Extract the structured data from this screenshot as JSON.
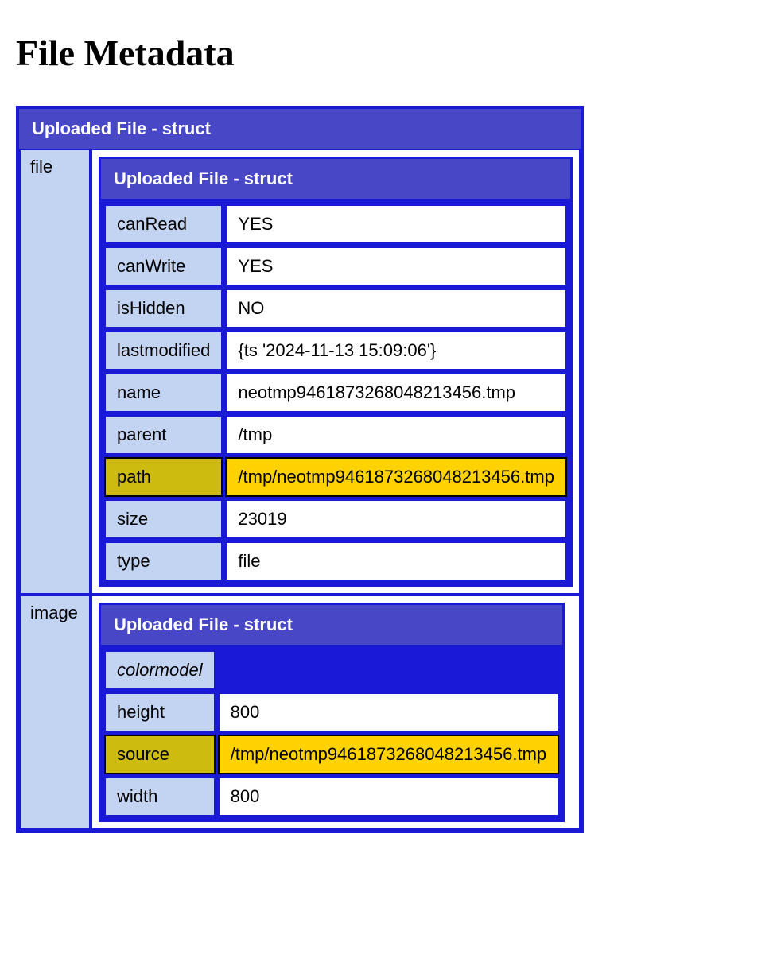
{
  "page_title": "File Metadata",
  "outer_struct_label": "Uploaded File - struct",
  "file_key": "file",
  "image_key": "image",
  "inner_struct_label": "Uploaded File - struct",
  "file_struct": {
    "canRead": {
      "k": "canRead",
      "v": "YES"
    },
    "canWrite": {
      "k": "canWrite",
      "v": "YES"
    },
    "isHidden": {
      "k": "isHidden",
      "v": "NO"
    },
    "lastmodified": {
      "k": "lastmodified",
      "v": "{ts '2024-11-13 15:09:06'}"
    },
    "name": {
      "k": "name",
      "v": "neotmp9461873268048213456.tmp"
    },
    "parent": {
      "k": "parent",
      "v": "/tmp"
    },
    "path": {
      "k": "path",
      "v": "/tmp/neotmp9461873268048213456.tmp"
    },
    "size": {
      "k": "size",
      "v": "23019"
    },
    "type": {
      "k": "type",
      "v": "file"
    }
  },
  "image_struct": {
    "colormodel": {
      "k": "colormodel",
      "v": ""
    },
    "height": {
      "k": "height",
      "v": "800"
    },
    "source": {
      "k": "source",
      "v": "/tmp/neotmp9461873268048213456.tmp"
    },
    "width": {
      "k": "width",
      "v": "800"
    }
  }
}
